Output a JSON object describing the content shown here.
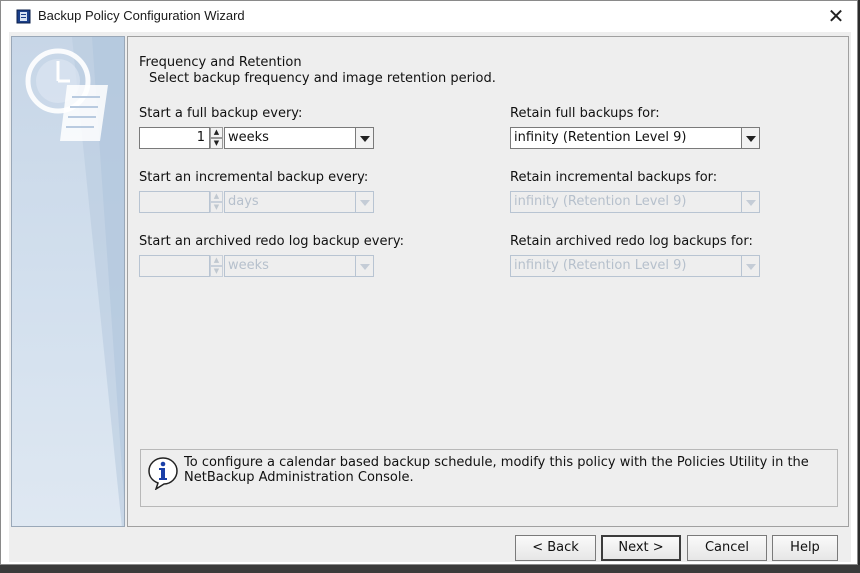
{
  "window": {
    "title": "Backup Policy Configuration Wizard"
  },
  "header": {
    "title": "Frequency and Retention",
    "subtitle": "Select backup frequency and image retention period."
  },
  "full_backup": {
    "label": "Start a full backup every:",
    "value": "1",
    "unit": "weeks",
    "retain_label": "Retain full backups for:",
    "retain_value": "infinity (Retention Level 9)",
    "enabled": true
  },
  "incremental_backup": {
    "label": "Start an incremental backup every:",
    "value": "",
    "unit": "days",
    "retain_label": "Retain incremental backups for:",
    "retain_value": "infinity (Retention Level 9)",
    "enabled": false
  },
  "redo_backup": {
    "label": "Start an archived redo log backup every:",
    "value": "",
    "unit": "weeks",
    "retain_label": "Retain archived redo log backups for:",
    "retain_value": "infinity (Retention Level 9)",
    "enabled": false
  },
  "info": {
    "text": "To configure a calendar based backup schedule, modify this policy with the Policies Utility in the NetBackup Administration Console.",
    "icon": "info-icon"
  },
  "buttons": {
    "back": "< Back",
    "next": "Next >",
    "cancel": "Cancel",
    "help": "Help"
  },
  "colors": {
    "sidebar": "#c7d6e7",
    "panel": "#eeeeee",
    "disabled_text": "#b6c0cc"
  }
}
